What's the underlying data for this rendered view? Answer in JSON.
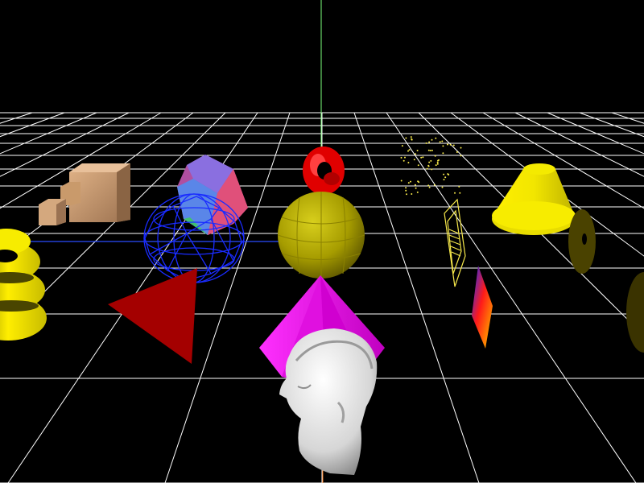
{
  "scene": {
    "background": "#000000",
    "grid_color": "#ffffff",
    "axes": {
      "x_color": "#2a4cff",
      "y_color": "#7dff7d",
      "z_color": "#ff7a1a"
    },
    "objects": [
      {
        "name": "torus-stack",
        "color": "#f2ec00"
      },
      {
        "name": "textured-boxes",
        "color": "#c99a6b"
      },
      {
        "name": "icosahedron",
        "color": "#c45a9a"
      },
      {
        "name": "wire-sphere",
        "color": "#1a2cff"
      },
      {
        "name": "red-triangle",
        "color": "#b00000"
      },
      {
        "name": "red-ring",
        "color": "#ff1010"
      },
      {
        "name": "olive-sphere",
        "color": "#b8ae00"
      },
      {
        "name": "magenta-cone",
        "color": "#ff10ff"
      },
      {
        "name": "head-bust",
        "color": "#ececec"
      },
      {
        "name": "point-cloud",
        "color": "#f6e84a"
      },
      {
        "name": "wire-prism",
        "color": "#f6e84a"
      },
      {
        "name": "gradient-quad",
        "color": "#ff6a00"
      },
      {
        "name": "yellow-frustum",
        "color": "#f6ec00"
      },
      {
        "name": "dark-disk",
        "color": "#4a4200"
      }
    ]
  }
}
